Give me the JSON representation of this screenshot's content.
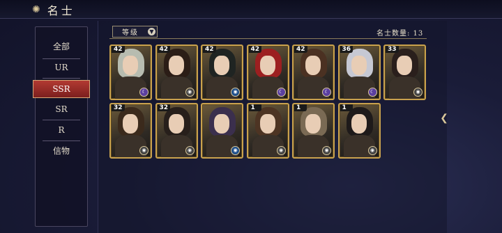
{
  "header": {
    "title": "名士"
  },
  "sidebar": {
    "items": [
      {
        "label": "全部"
      },
      {
        "label": "UR"
      },
      {
        "label": "SSR"
      },
      {
        "label": "SR"
      },
      {
        "label": "R"
      },
      {
        "label": "信物"
      }
    ],
    "active": "SSR"
  },
  "filter": {
    "label": "等级"
  },
  "count_label": "名士数量: 13",
  "cards": [
    {
      "level": "42",
      "hair": "#b7bcb0",
      "badge": "#5b3fa0",
      "badge_icon": "moon-icon"
    },
    {
      "level": "42",
      "hair": "#2b1d16",
      "badge": "#444",
      "badge_icon": "eye-icon"
    },
    {
      "level": "42",
      "hair": "#1f2422",
      "badge": "#1f4f8a",
      "badge_icon": "eye-icon"
    },
    {
      "level": "42",
      "hair": "#9c1f20",
      "badge": "#5b3fa0",
      "badge_icon": "moon-icon"
    },
    {
      "level": "42",
      "hair": "#4b3122",
      "badge": "#5b3fa0",
      "badge_icon": "moon-icon"
    },
    {
      "level": "36",
      "hair": "#c6c8d3",
      "badge": "#5b3fa0",
      "badge_icon": "moon-icon"
    },
    {
      "level": "33",
      "hair": "#2a1f1c",
      "badge": "#444",
      "badge_icon": "eye-icon"
    },
    {
      "level": "32",
      "hair": "#3b2a1c",
      "badge": "#444",
      "badge_icon": "eye-icon"
    },
    {
      "level": "32",
      "hair": "#271f1b",
      "badge": "#444",
      "badge_icon": "eye-icon"
    },
    {
      "level": "",
      "hair": "#3b2f4d",
      "badge": "#1f4f8a",
      "badge_icon": "eye-icon"
    },
    {
      "level": "1",
      "hair": "#4d3423",
      "badge": "#444",
      "badge_icon": "eye-icon"
    },
    {
      "level": "1",
      "hair": "#7a6a54",
      "badge": "#444",
      "badge_icon": "eye-icon"
    },
    {
      "level": "1",
      "hair": "#1e1a1a",
      "badge": "#444",
      "badge_icon": "eye-icon"
    }
  ]
}
